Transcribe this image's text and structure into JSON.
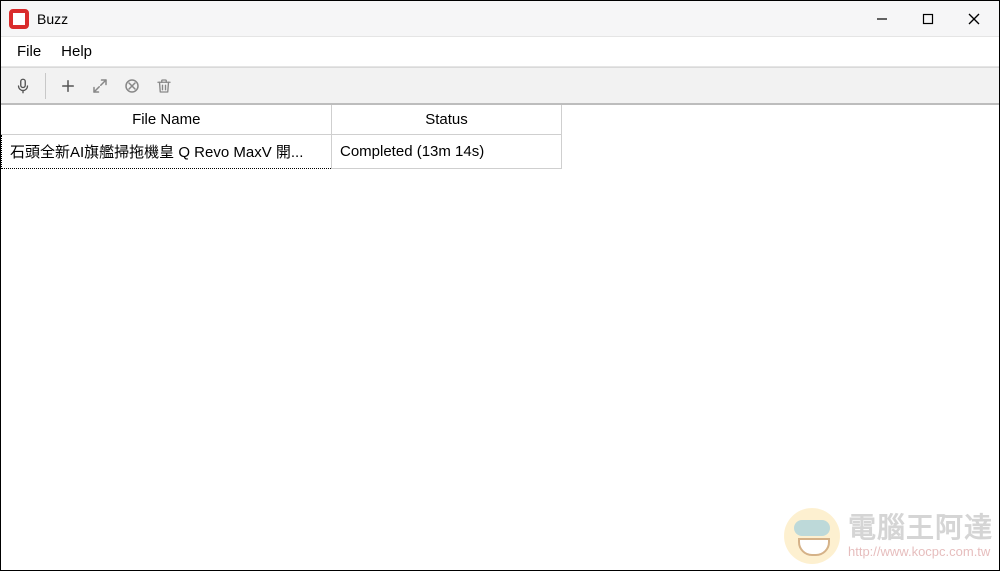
{
  "window": {
    "title": "Buzz"
  },
  "menu": {
    "file": "File",
    "help": "Help"
  },
  "toolbar": {
    "record": "record",
    "add": "add",
    "expand": "expand",
    "cancel": "cancel",
    "delete": "delete"
  },
  "table": {
    "headers": {
      "file_name": "File Name",
      "status": "Status"
    },
    "rows": [
      {
        "file_name": "石頭全新AI旗艦掃拖機皇 Q Revo MaxV 開...",
        "status": "Completed (13m 14s)"
      }
    ]
  },
  "watermark": {
    "title": "電腦王阿達",
    "url": "http://www.kocpc.com.tw"
  }
}
